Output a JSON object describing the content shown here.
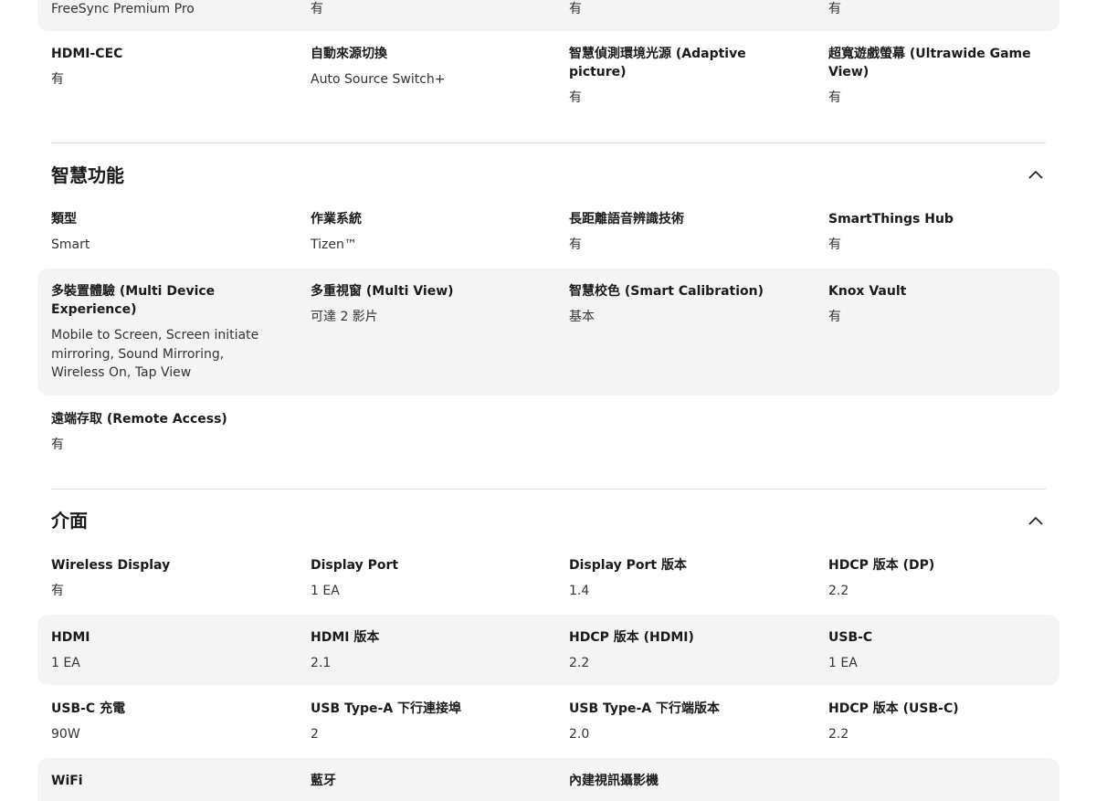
{
  "top_row": [
    {
      "label": "",
      "value": "FreeSync Premium Pro"
    },
    {
      "label": "",
      "value": "有"
    },
    {
      "label": "",
      "value": "有"
    },
    {
      "label": "",
      "value": "有"
    }
  ],
  "row_cec": [
    {
      "label": "HDMI-CEC",
      "value": "有"
    },
    {
      "label": "自動來源切換",
      "value": "Auto Source Switch+"
    },
    {
      "label": "智慧偵測環境光源 (Adaptive picture)",
      "value": "有"
    },
    {
      "label": "超寬遊戲螢幕 (Ultrawide Game View)",
      "value": "有"
    }
  ],
  "smart": {
    "title": "智慧功能",
    "collapse_icon": "chevron-up-icon",
    "rows": [
      [
        {
          "label": "類型",
          "value": "Smart"
        },
        {
          "label": "作業系統",
          "value": "Tizen™"
        },
        {
          "label": "長距離語音辨識技術",
          "value": "有"
        },
        {
          "label": "SmartThings Hub",
          "value": "有"
        }
      ],
      [
        {
          "label": "多裝置體驗 (Multi Device Experience)",
          "value": "Mobile to Screen, Screen initiate mirroring, Sound Mirroring, Wireless On, Tap View"
        },
        {
          "label": "多重視窗 (Multi View)",
          "value": "可達 2 影片"
        },
        {
          "label": "智慧校色 (Smart Calibration)",
          "value": "基本"
        },
        {
          "label": "Knox Vault",
          "value": "有"
        }
      ],
      [
        {
          "label": "遠端存取 (Remote Access)",
          "value": "有"
        }
      ]
    ]
  },
  "interface": {
    "title": "介面",
    "collapse_icon": "chevron-up-icon",
    "rows": [
      [
        {
          "label": "Wireless Display",
          "value": "有"
        },
        {
          "label": "Display Port",
          "value": "1 EA"
        },
        {
          "label": "Display Port 版本",
          "value": "1.4"
        },
        {
          "label": "HDCP 版本 (DP)",
          "value": "2.2"
        }
      ],
      [
        {
          "label": "HDMI",
          "value": "1 EA"
        },
        {
          "label": "HDMI 版本",
          "value": "2.1"
        },
        {
          "label": "HDCP 版本 (HDMI)",
          "value": "2.2"
        },
        {
          "label": "USB-C",
          "value": "1 EA"
        }
      ],
      [
        {
          "label": "USB-C 充電",
          "value": "90W"
        },
        {
          "label": "USB Type-A 下行連接埠",
          "value": "2"
        },
        {
          "label": "USB Type-A 下行端版本",
          "value": "2.0"
        },
        {
          "label": "HDCP 版本 (USB-C)",
          "value": "2.2"
        }
      ],
      [
        {
          "label": "WiFi",
          "value": ""
        },
        {
          "label": "藍牙",
          "value": ""
        },
        {
          "label": "內建視訊攝影機",
          "value": ""
        }
      ]
    ]
  }
}
